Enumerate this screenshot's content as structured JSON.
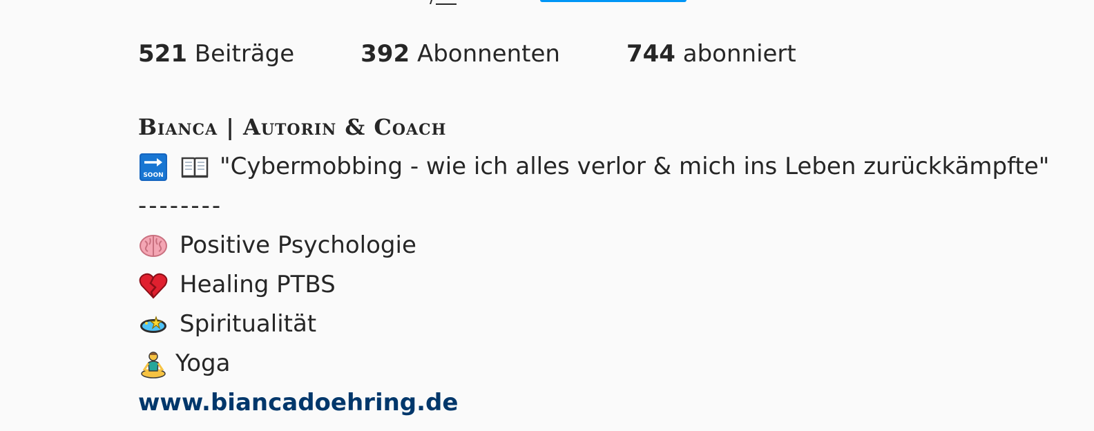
{
  "stats": {
    "posts_count": "521",
    "posts_label": "Beiträge",
    "followers_count": "392",
    "followers_label": "Abonnenten",
    "following_count": "744",
    "following_label": "abonniert"
  },
  "bio": {
    "name": "Bianca | Autorin  &  Coach",
    "book_line": "\"Cybermobbing - wie ich alles verlor & mich ins Leben zurückkämpfte\"",
    "divider": "--------",
    "topics": [
      {
        "icon": "brain-icon",
        "label": "Positive Psychologie"
      },
      {
        "icon": "broken-heart-icon",
        "label": "Healing PTBS"
      },
      {
        "icon": "dizzy-star-icon",
        "label": "Spiritualität"
      },
      {
        "icon": "yoga-icon",
        "label": "Yoga"
      }
    ],
    "website": "www.biancadoehring.de"
  },
  "colors": {
    "text": "#262626",
    "link": "#00376b",
    "accent_button": "#0095f6",
    "background": "#fafafa"
  },
  "icons": {
    "soon": "soon-arrow-icon",
    "book": "open-book-icon"
  }
}
